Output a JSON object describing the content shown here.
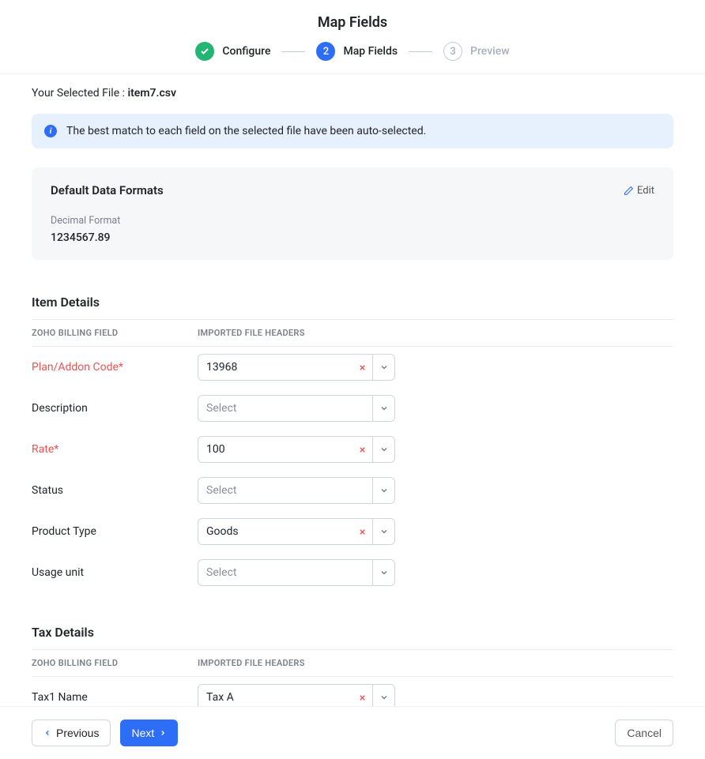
{
  "title": "Map Fields",
  "steps": [
    {
      "label": "Configure",
      "state": "done",
      "num": "✓"
    },
    {
      "label": "Map Fields",
      "state": "active",
      "num": "2"
    },
    {
      "label": "Preview",
      "state": "pending",
      "num": "3"
    }
  ],
  "file": {
    "prefix": "Your Selected File : ",
    "name": "item7.csv"
  },
  "info_banner": "The best match to each field on the selected file have been auto-selected.",
  "formats": {
    "title": "Default Data Formats",
    "edit_label": "Edit",
    "decimal_label": "Decimal Format",
    "decimal_value": "1234567.89"
  },
  "columns": {
    "zoho": "ZOHO BILLING FIELD",
    "imported": "IMPORTED FILE HEADERS"
  },
  "placeholder": "Select",
  "item_details": {
    "title": "Item Details",
    "rows": [
      {
        "label": "Plan/Addon Code*",
        "value": "13968",
        "clearable": true,
        "required": true
      },
      {
        "label": "Description",
        "value": "",
        "clearable": false,
        "required": false
      },
      {
        "label": "Rate*",
        "value": "100",
        "clearable": true,
        "required": true
      },
      {
        "label": "Status",
        "value": "",
        "clearable": false,
        "required": false
      },
      {
        "label": "Product Type",
        "value": "Goods",
        "clearable": true,
        "required": false
      },
      {
        "label": "Usage unit",
        "value": "",
        "clearable": false,
        "required": false
      }
    ]
  },
  "tax_details": {
    "title": "Tax Details",
    "rows": [
      {
        "label": "Tax1 Name",
        "value": "Tax A",
        "clearable": true,
        "required": false
      }
    ]
  },
  "footer": {
    "prev": "Previous",
    "next": "Next",
    "cancel": "Cancel"
  }
}
